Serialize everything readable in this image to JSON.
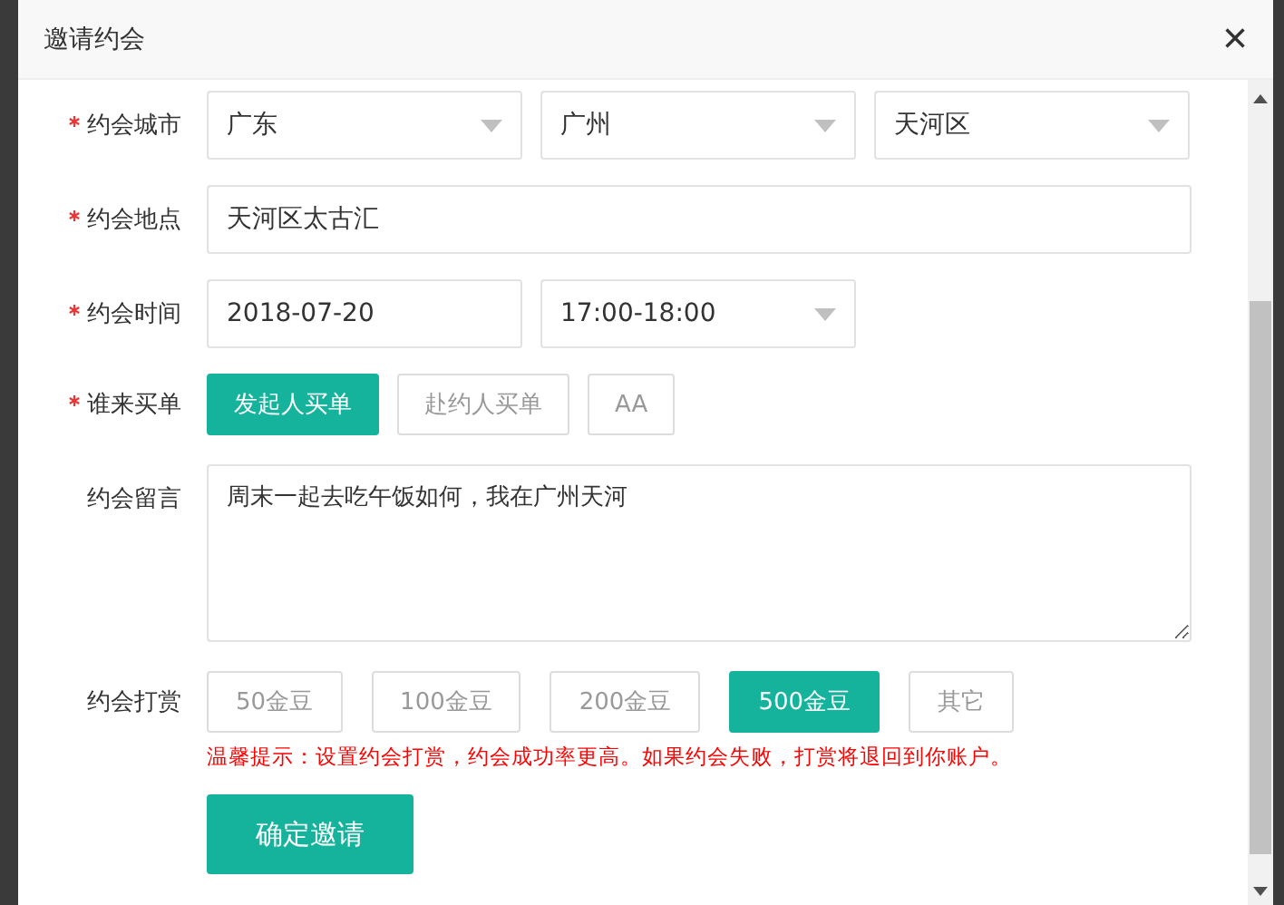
{
  "dialog": {
    "title": "邀请约会",
    "close": "×"
  },
  "city": {
    "label": "约会城市",
    "required": true,
    "selects": [
      {
        "value": "广东"
      },
      {
        "value": "广州"
      },
      {
        "value": "天河区"
      }
    ]
  },
  "place": {
    "label": "约会地点",
    "required": true,
    "value": "天河区太古汇"
  },
  "time": {
    "label": "约会时间",
    "required": true,
    "date": "2018-07-20",
    "slot": "17:00-18:00"
  },
  "payer": {
    "label": "谁来买单",
    "required": true,
    "options": [
      {
        "label": "发起人买单",
        "selected": true
      },
      {
        "label": "赴约人买单",
        "selected": false
      },
      {
        "label": "AA",
        "selected": false
      }
    ]
  },
  "message": {
    "label": "约会留言",
    "required": false,
    "value": "周末一起去吃午饭如何，我在广州天河"
  },
  "reward": {
    "label": "约会打赏",
    "required": false,
    "options": [
      {
        "label": "50金豆",
        "selected": false
      },
      {
        "label": "100金豆",
        "selected": false
      },
      {
        "label": "200金豆",
        "selected": false
      },
      {
        "label": "500金豆",
        "selected": true
      },
      {
        "label": "其它",
        "selected": false
      }
    ]
  },
  "hint": "温馨提示：设置约会打赏，约会成功率更高。如果约会失败，打赏将退回到你账户。",
  "submit": "确定邀请"
}
